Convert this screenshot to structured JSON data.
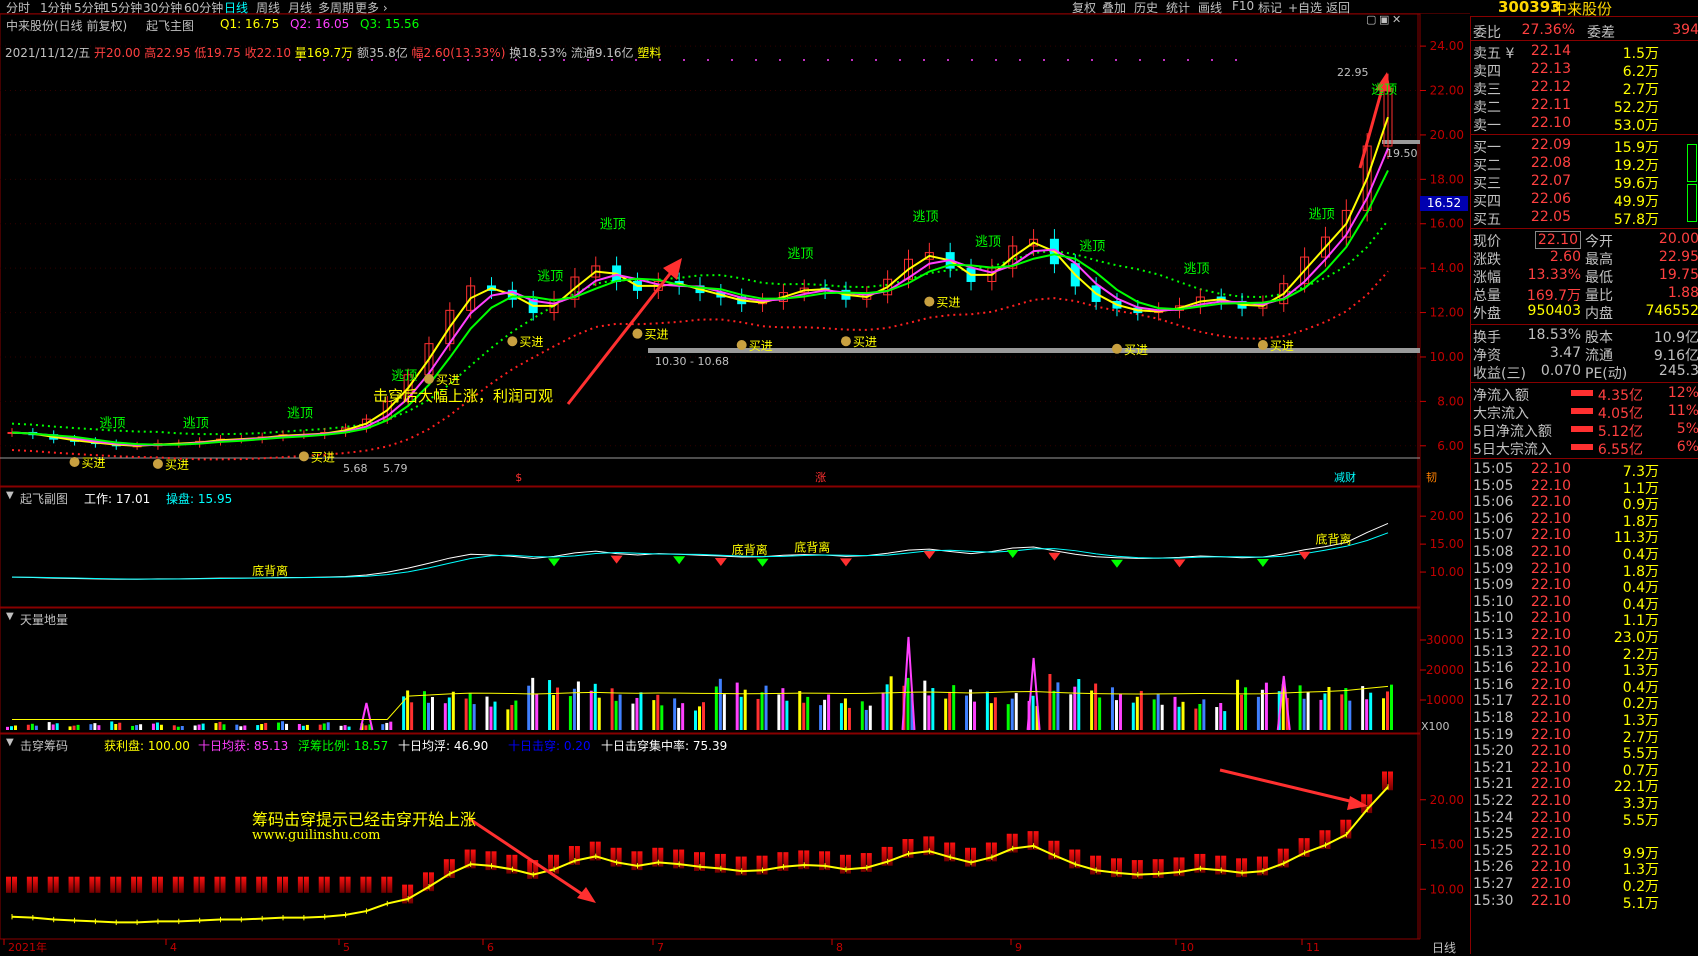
{
  "topbar": {
    "periods": [
      "分时",
      "1分钟",
      "5分钟",
      "15分钟",
      "30分钟",
      "60分钟",
      "日线",
      "周线",
      "月线",
      "多周期",
      "更多 ›"
    ],
    "active": "日线",
    "tools": [
      "复权",
      "叠加",
      "历史",
      "统计",
      "画线",
      "F10",
      "标记",
      "+自选",
      "返回"
    ]
  },
  "stock": {
    "code": "300393",
    "name": "中来股份"
  },
  "main_header": {
    "title": "中来股份(日线 前复权)",
    "indicator": "起飞主图",
    "q1": "Q1: 16.75",
    "q2": "Q2: 16.05",
    "q3": "Q3: 15.56"
  },
  "ohlc_line": {
    "date": "2021/11/12/五",
    "open": "开20.00",
    "high": "高22.95",
    "low": "低19.75",
    "close": "收22.10",
    "vol": "量169.7万",
    "amount": "额35.8亿",
    "change": "幅2.60(13.33%)",
    "turnover": "换18.53%",
    "float": "流通9.16亿",
    "sector": "塑料"
  },
  "annotations": {
    "main_note": "击穿后大幅上涨，利润可观",
    "chip_note": "筹码击穿提示已经击穿开始上涨",
    "url": "www.guilinshu.com",
    "level_label": "10.30 - 10.68",
    "high_label": "22.95",
    "resist_label": "19.50",
    "left_lows": [
      "5.68",
      "5.79"
    ],
    "current_tag": "16.52"
  },
  "signal_labels": {
    "top": "逃顶",
    "buy": "买进",
    "bottom_div": "底背离",
    "markers": [
      "$",
      "涨",
      "减财",
      "韧"
    ]
  },
  "panels": {
    "main_axis": [
      "24.00",
      "22.00",
      "20.00",
      "18.00",
      "16.00",
      "14.00",
      "12.00",
      "10.00",
      "8.00",
      "6.00"
    ],
    "sub1": {
      "title": "起飞副图",
      "work": "工作: 17.01",
      "op": "操盘: 15.95",
      "axis": [
        "20.00",
        "15.00",
        "10.00"
      ]
    },
    "sub2": {
      "title": "天量地量",
      "axis": [
        "30000",
        "20000",
        "10000"
      ],
      "unit": "X100"
    },
    "sub3": {
      "title": "击穿筹码",
      "profit": "获利盘: 100.00",
      "avg10": "十日均获: 85.13",
      "ratio": "浮筹比例: 18.57",
      "avg10f": "十日均浮: 46.90",
      "hit10": "十日击穿: 0.20",
      "conc10": "十日击穿集中率: 75.39",
      "axis": [
        "20.00",
        "15.00",
        "10.00"
      ]
    }
  },
  "x_axis": {
    "labels": [
      "2021年",
      "4",
      "5",
      "6",
      "7",
      "8",
      "9",
      "10",
      "11"
    ],
    "period": "日线"
  },
  "right_panel": {
    "ratio": {
      "label": "委比",
      "value": "27.36%",
      "diff_label": "委差",
      "diff": "394"
    },
    "asks": [
      {
        "label": "卖五 ¥",
        "price": "22.14",
        "vol": "1.5万"
      },
      {
        "label": "卖四",
        "price": "22.13",
        "vol": "6.2万"
      },
      {
        "label": "卖三",
        "price": "22.12",
        "vol": "2.7万"
      },
      {
        "label": "卖二",
        "price": "22.11",
        "vol": "52.2万"
      },
      {
        "label": "卖一",
        "price": "22.10",
        "vol": "53.0万"
      }
    ],
    "bids": [
      {
        "label": "买一",
        "price": "22.09",
        "vol": "15.9万"
      },
      {
        "label": "买二",
        "price": "22.08",
        "vol": "19.2万"
      },
      {
        "label": "买三",
        "price": "22.07",
        "vol": "59.6万"
      },
      {
        "label": "买四",
        "price": "22.06",
        "vol": "49.9万"
      },
      {
        "label": "买五",
        "price": "22.05",
        "vol": "57.8万"
      }
    ],
    "quote": [
      {
        "l1": "现价",
        "v1": "22.10",
        "l2": "今开",
        "v2": "20.00"
      },
      {
        "l1": "涨跌",
        "v1": "2.60",
        "l2": "最高",
        "v2": "22.95"
      },
      {
        "l1": "涨幅",
        "v1": "13.33%",
        "l2": "最低",
        "v2": "19.75"
      },
      {
        "l1": "总量",
        "v1": "169.7万",
        "l2": "量比",
        "v2": "1.88"
      },
      {
        "l1": "外盘",
        "v1": "950403",
        "l2": "内盘",
        "v2": "746552"
      }
    ],
    "fund": [
      {
        "l1": "换手",
        "v1": "18.53%",
        "l2": "股本",
        "v2": "10.9亿"
      },
      {
        "l1": "净资",
        "v1": "3.47",
        "l2": "流通",
        "v2": "9.16亿"
      },
      {
        "l1": "收益(三)",
        "v1": "0.070",
        "l2": "PE(动)",
        "v2": "245.3"
      }
    ],
    "flows": [
      {
        "label": "净流入额",
        "value": "4.35亿",
        "pct": "12%"
      },
      {
        "label": "大宗流入",
        "value": "4.05亿",
        "pct": "11%"
      },
      {
        "label": "5日净流入额",
        "value": "5.12亿",
        "pct": "5%"
      },
      {
        "label": "5日大宗流入",
        "value": "6.55亿",
        "pct": "6%"
      }
    ],
    "ticks": [
      [
        "15:05",
        "22.10",
        "7.3万"
      ],
      [
        "15:05",
        "22.10",
        "1.1万"
      ],
      [
        "15:06",
        "22.10",
        "0.9万"
      ],
      [
        "15:06",
        "22.10",
        "1.8万"
      ],
      [
        "15:07",
        "22.10",
        "11.3万"
      ],
      [
        "15:08",
        "22.10",
        "0.4万"
      ],
      [
        "15:09",
        "22.10",
        "1.8万"
      ],
      [
        "15:09",
        "22.10",
        "0.4万"
      ],
      [
        "15:10",
        "22.10",
        "0.4万"
      ],
      [
        "15:10",
        "22.10",
        "1.1万"
      ],
      [
        "15:13",
        "22.10",
        "23.0万"
      ],
      [
        "15:13",
        "22.10",
        "2.2万"
      ],
      [
        "15:16",
        "22.10",
        "1.3万"
      ],
      [
        "15:16",
        "22.10",
        "0.4万"
      ],
      [
        "15:17",
        "22.10",
        "0.2万"
      ],
      [
        "15:18",
        "22.10",
        "1.3万"
      ],
      [
        "15:19",
        "22.10",
        "2.7万"
      ],
      [
        "15:20",
        "22.10",
        "5.5万"
      ],
      [
        "15:21",
        "22.10",
        "0.7万"
      ],
      [
        "15:21",
        "22.10",
        "22.1万"
      ],
      [
        "15:22",
        "22.10",
        "3.3万"
      ],
      [
        "15:24",
        "22.10",
        "5.5万"
      ],
      [
        "15:25",
        "22.10",
        ""
      ],
      [
        "15:25",
        "22.10",
        "9.9万"
      ],
      [
        "15:26",
        "22.10",
        "1.3万"
      ],
      [
        "15:27",
        "22.10",
        "0.2万"
      ],
      [
        "15:30",
        "22.10",
        "5.1万"
      ]
    ]
  },
  "chart_data": {
    "type": "line",
    "title": "中来股份(日线 前复权)",
    "x": [
      "2021年",
      "4",
      "5",
      "6",
      "7",
      "8",
      "9",
      "10",
      "11"
    ],
    "ylim": [
      5,
      24.5
    ],
    "series": [
      {
        "values": [
          6.6,
          6.5,
          6.3,
          6.2,
          6.1,
          6.0,
          6.0,
          6.1,
          6.1,
          6.2,
          6.3,
          6.3,
          6.4,
          6.5,
          6.5,
          6.6,
          6.8,
          7.2,
          8.0,
          9.2,
          10.6,
          12.1,
          13.2,
          13.0,
          12.6,
          12.0,
          12.6,
          13.6,
          14.1,
          13.4,
          13.0,
          13.4,
          13.2,
          12.9,
          12.7,
          12.4,
          12.5,
          12.9,
          13.1,
          13.0,
          12.6,
          12.8,
          13.5,
          14.4,
          14.7,
          14.0,
          13.4,
          14.0,
          15.0,
          15.3,
          14.2,
          13.2,
          12.5,
          12.2,
          12.0,
          12.1,
          12.3,
          12.7,
          12.5,
          12.2,
          12.4,
          13.3,
          14.5,
          15.4,
          16.6,
          19.5,
          22.1
        ]
      }
    ],
    "reference_levels": [
      {
        "label": "10.30 - 10.68",
        "value": 10.5
      },
      {
        "label": "19.50",
        "value": 19.5
      }
    ]
  }
}
